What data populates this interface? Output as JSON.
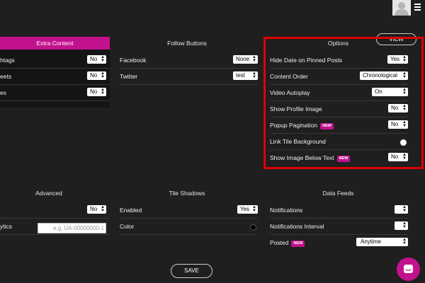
{
  "topbar": {
    "avatar": "avatar-placeholder-icon",
    "menu": "hamburger-icon"
  },
  "extra_content": {
    "title": "Extra Content",
    "rows": [
      {
        "label": "htags",
        "value": "No"
      },
      {
        "label": "eets",
        "value": "No"
      },
      {
        "label": "es",
        "value": "No"
      }
    ]
  },
  "follow_buttons": {
    "title": "Follow Buttons",
    "rows": [
      {
        "label": "Facebook",
        "value": "None"
      },
      {
        "label": "Twitter",
        "value": "test"
      }
    ]
  },
  "options": {
    "title": "Options",
    "view_label": "VIEW",
    "rows": [
      {
        "label": "Hide Date on Pinned Posts",
        "value": "Yes"
      },
      {
        "label": "Content Order",
        "value": "Chronological"
      },
      {
        "label": "Video Autoplay",
        "value": "On"
      },
      {
        "label": "Show Profile Image",
        "value": "No"
      },
      {
        "label": "Popup Pagination",
        "badge": "NEW",
        "value": "No"
      },
      {
        "label": "Link Tile Background",
        "color": "#ffffff"
      },
      {
        "label": "Show Image Below Text",
        "badge": "NEW",
        "value": "No"
      }
    ]
  },
  "advanced": {
    "title": "Advanced",
    "rows": [
      {
        "label": "",
        "value": "No"
      },
      {
        "label": "ytics",
        "placeholder": "e.g. UA-00000000-1"
      }
    ]
  },
  "tile_shadows": {
    "title": "Tile Shadows",
    "rows": [
      {
        "label": "Enabled",
        "value": "Yes"
      },
      {
        "label": "Color",
        "color": "#000000"
      }
    ]
  },
  "data_feeds": {
    "title": "Data Feeds",
    "rows": [
      {
        "label": "Notifications",
        "value": ""
      },
      {
        "label": "Notifications Interval",
        "value": ""
      },
      {
        "label": "Posted",
        "badge": "NEW",
        "value": "Anytime"
      }
    ]
  },
  "save_label": "SAVE",
  "chat": {
    "icon": "chat-bubble-icon",
    "color": "#c3128e"
  },
  "accent_color": "#c3128e",
  "highlight_color": "#e00000"
}
